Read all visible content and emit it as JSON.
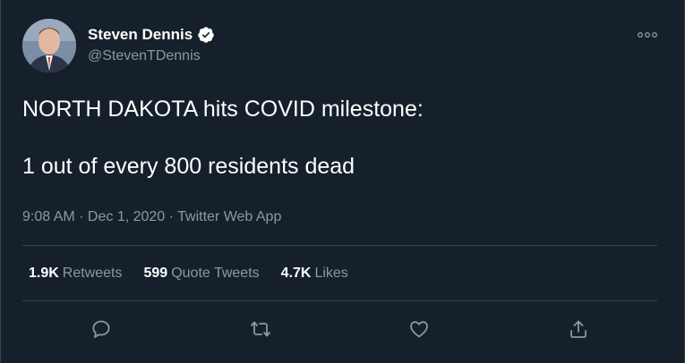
{
  "author": {
    "display_name": "Steven Dennis",
    "handle": "@StevenTDennis",
    "verified_icon": "verified-badge-icon",
    "avatar_icon": "avatar-photo"
  },
  "tweet": {
    "line1": "NORTH DAKOTA hits COVID milestone:",
    "line2": "1 out of every 800 residents dead"
  },
  "meta": {
    "time": "9:08 AM",
    "sep1": " · ",
    "date": "Dec 1, 2020",
    "sep2": " · ",
    "source": "Twitter Web App"
  },
  "stats": {
    "retweets_count": "1.9K",
    "retweets_label": "Retweets",
    "quotes_count": "599",
    "quotes_label": "Quote Tweets",
    "likes_count": "4.7K",
    "likes_label": "Likes"
  },
  "actions": {
    "reply": "reply-icon",
    "retweet": "retweet-icon",
    "like": "heart-icon",
    "share": "share-icon"
  },
  "colors": {
    "background": "#15202b",
    "text_primary": "#ffffff",
    "text_secondary": "#8899a6",
    "border": "#38444d"
  }
}
